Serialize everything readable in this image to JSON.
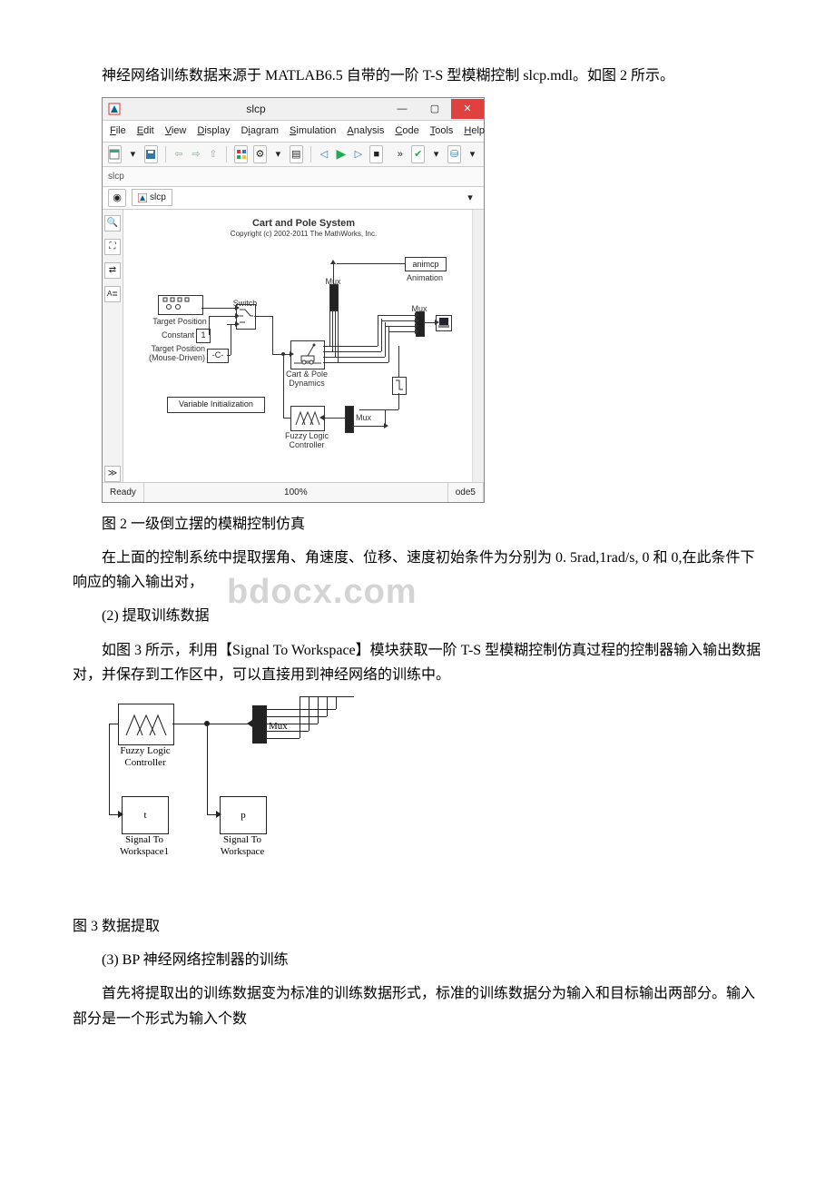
{
  "text": {
    "p1": "神经网络训练数据来源于 MATLAB6.5 自带的一阶 T-S 型模糊控制 slcp.mdl。如图 2 所示。",
    "fig2_caption": "图 2 一级倒立摆的模糊控制仿真",
    "p2": "在上面的控制系统中提取摆角、角速度、位移、速度初始条件为分别为 0. 5rad,1rad/s, 0 和 0,在此条件下响应的输入输出对，",
    "h2": "(2) 提取训练数据",
    "p3": "如图 3 所示，利用【Signal To Workspace】模块获取一阶 T-S 型模糊控制仿真过程的控制器输入输出数据对，并保存到工作区中，可以直接用到神经网络的训练中。",
    "fig3_caption": "图 3 数据提取",
    "h3": "(3) BP 神经网络控制器的训练",
    "p4": "首先将提取出的训练数据变为标准的训练数据形式，标准的训练数据分为输入和目标输出两部分。输入部分是一个形式为输入个数"
  },
  "watermark": "bdocx.com",
  "simwin": {
    "title": "slcp",
    "menu": {
      "file": "File",
      "edit": "Edit",
      "view": "View",
      "display": "Display",
      "diagram": "Diagram",
      "simulation": "Simulation",
      "analysis": "Analysis",
      "code": "Code",
      "tools": "Tools",
      "help": "Help"
    },
    "tabs": "slcp",
    "path": "slcp",
    "canvas": {
      "title": "Cart and Pole System",
      "copyright": "Copyright (c) 2002-2011 The MathWorks, Inc.",
      "blocks": {
        "animcp": "animcp",
        "animation": "Animation",
        "mux1": "Mux",
        "mux2": "Mux",
        "mux3": "Mux",
        "target_position": "Target Position",
        "constant": "Constant",
        "const_val": "1",
        "tp_mouse1": "Target Position",
        "tp_mouse2": "(Mouse-Driven)",
        "tp_mouse_v": "-C-",
        "switch": "Switch",
        "cart_pole1": "Cart & Pole",
        "cart_pole2": "Dynamics",
        "var_init": "Variable Initialization",
        "fuzzy1": "Fuzzy Logic",
        "fuzzy2": "Controller"
      }
    },
    "status": {
      "ready": "Ready",
      "pct": "100%",
      "solver": "ode5"
    }
  },
  "fig3": {
    "mux": "Mux",
    "fuzzy1": "Fuzzy Logic",
    "fuzzy2": "Controller",
    "t": "t",
    "p": "p",
    "stw1": "Signal To",
    "stw2": "Workspace1",
    "stw3": "Signal To",
    "stw4": "Workspace"
  }
}
